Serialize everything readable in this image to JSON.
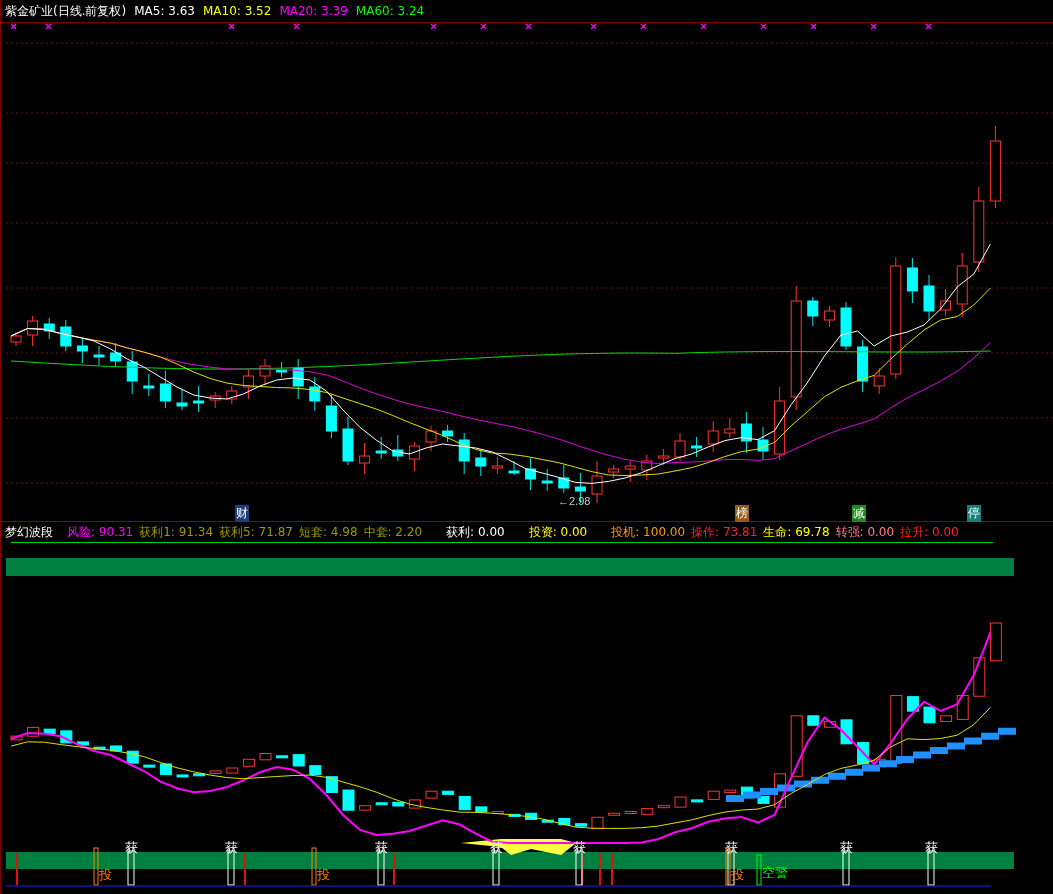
{
  "main_chart": {
    "title": "紫金矿业(日线.前复权)",
    "ma_readings": [
      {
        "label": "MA5:",
        "value": "3.63",
        "color": "#ffffff"
      },
      {
        "label": "MA10:",
        "value": "3.52",
        "color": "#ffff00"
      },
      {
        "label": "MA20:",
        "value": "3.39",
        "color": "#ff00ff"
      },
      {
        "label": "MA60:",
        "value": "3.24",
        "color": "#00ff00"
      }
    ],
    "low_marker": "←2.98",
    "event_tags": [
      {
        "text": "财",
        "color": "#1c3f7a"
      },
      {
        "text": "榜",
        "color": "#9a5a14"
      },
      {
        "text": "减",
        "color": "#1f8a1f"
      },
      {
        "text": "停",
        "color": "#137f7f"
      }
    ]
  },
  "indicator": {
    "title": "梦幻波段",
    "readings": [
      {
        "label": "风险:",
        "value": "90.31",
        "color": "#ff00ff"
      },
      {
        "label": "获利1:",
        "value": "91.34",
        "color": "#999900"
      },
      {
        "label": "获利5:",
        "value": "71.87",
        "color": "#999900"
      },
      {
        "label": "短套:",
        "value": "4.98",
        "color": "#999900"
      },
      {
        "label": "中套:",
        "value": "2.20",
        "color": "#999900"
      },
      {
        "label": "获利:",
        "value": "0.00",
        "color": "#ffffff"
      },
      {
        "label": "投资:",
        "value": "0.00",
        "color": "#ffff00"
      },
      {
        "label": "投机:",
        "value": "100.00",
        "color": "#ff9900"
      },
      {
        "label": "操作:",
        "value": "73.81",
        "color": "#ff2020"
      },
      {
        "label": "生命:",
        "value": "69.78",
        "color": "#ffff00"
      },
      {
        "label": "转强:",
        "value": "0.00",
        "color": "#ff8080"
      },
      {
        "label": "拉升:",
        "value": "0.00",
        "color": "#ff2020"
      }
    ],
    "signals": [
      {
        "kind": "invest",
        "text": "投"
      },
      {
        "kind": "profit",
        "text": "获"
      },
      {
        "kind": "profit",
        "text": "获"
      },
      {
        "kind": "invest",
        "text": "投"
      },
      {
        "kind": "profit",
        "text": "获"
      },
      {
        "kind": "profit",
        "text": "获"
      },
      {
        "kind": "profit",
        "text": "获"
      },
      {
        "kind": "profit",
        "text": "获"
      },
      {
        "kind": "invest",
        "text": "投"
      },
      {
        "kind": "warning",
        "text": "空警"
      },
      {
        "kind": "profit",
        "text": "获"
      },
      {
        "kind": "profit",
        "text": "获"
      }
    ]
  }
}
